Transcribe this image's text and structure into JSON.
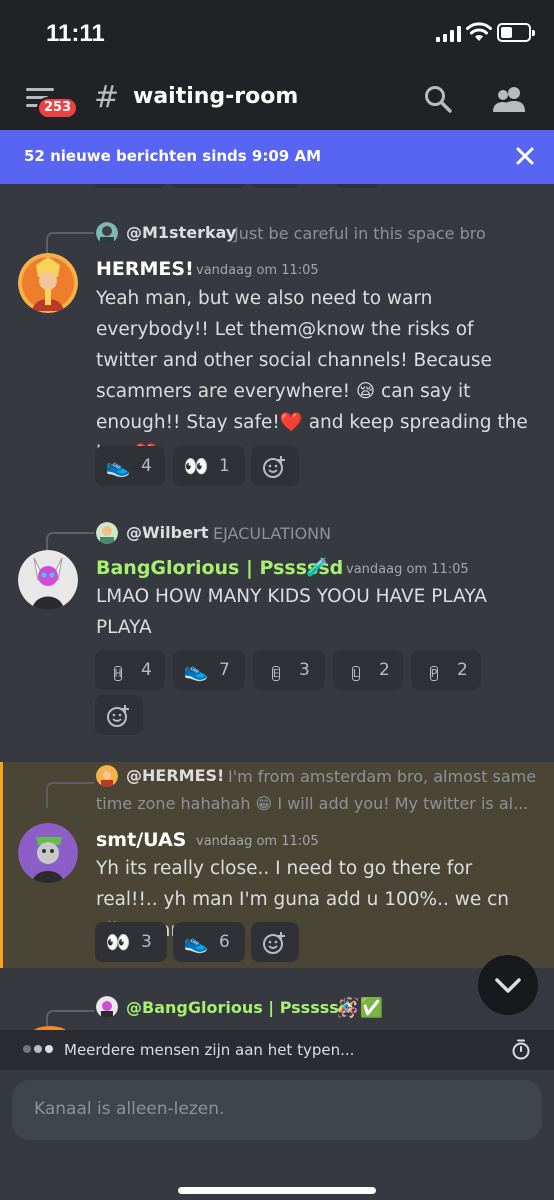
{
  "status_bar": {
    "time": "11:11"
  },
  "header": {
    "badge_count": "253",
    "hash": "#",
    "channel": "waiting-room"
  },
  "banner": {
    "text": "52 nieuwe berichten sinds 9:09 AM"
  },
  "messages": [
    {
      "reply_user": "@M1sterkay",
      "reply_text": "Just be careful in this space bro",
      "username": "HERMES!",
      "timestamp": "vandaag om 11:05",
      "content": "Yeah man, but we also need to warn everybody!! Let them@know the risks of twitter and other social channels! Because scammers are everywhere! 😪 can say it enough!! Stay safe!❤️ and keep spreading the love❤️",
      "reactions": [
        {
          "emoji": "👟",
          "count": "4"
        },
        {
          "emoji": "👀",
          "count": "1"
        }
      ]
    },
    {
      "reply_user": "@Wilbert",
      "reply_text": "EJACULATIONN",
      "username": "BangGlorious | Psssssd",
      "username_emoji": "🧪",
      "username_color": "#a7f070",
      "timestamp": "vandaag om 11:05",
      "content": "LMAO HOW MANY KIDS YOOU HAVE PLAYA PLAYA",
      "reactions": [
        {
          "emoji": "H",
          "count": "4"
        },
        {
          "emoji": "👟",
          "count": "7"
        },
        {
          "emoji": "E",
          "count": "3"
        },
        {
          "emoji": "L",
          "count": "2"
        },
        {
          "emoji": "P",
          "count": "2"
        }
      ]
    },
    {
      "reply_user": "@HERMES!",
      "reply_text_line1": "I'm from amsterdam bro, almost same",
      "reply_text_line2": "time zone hahahah 😁 I will add you! My twitter is al...",
      "username": "smt/UAS",
      "timestamp": "vandaag om 11:05",
      "content": "Yh its really close.. I need to go there for real!!.. yh man I'm guna add u 100%.. we cn vibe man",
      "reactions": [
        {
          "emoji": "👀",
          "count": "3"
        },
        {
          "emoji": "👟",
          "count": "6"
        }
      ]
    },
    {
      "reply_user": "@BangGlorious | Psssssd",
      "reply_emojis": "🪅✅"
    }
  ],
  "typing": {
    "text": "Meerdere mensen zijn aan het typen..."
  },
  "input": {
    "placeholder": "Kanaal is alleen-lezen."
  },
  "colors": {
    "accent": "#5865f2",
    "highlight_bar": "#faa61a",
    "badge": "#ed4245"
  }
}
